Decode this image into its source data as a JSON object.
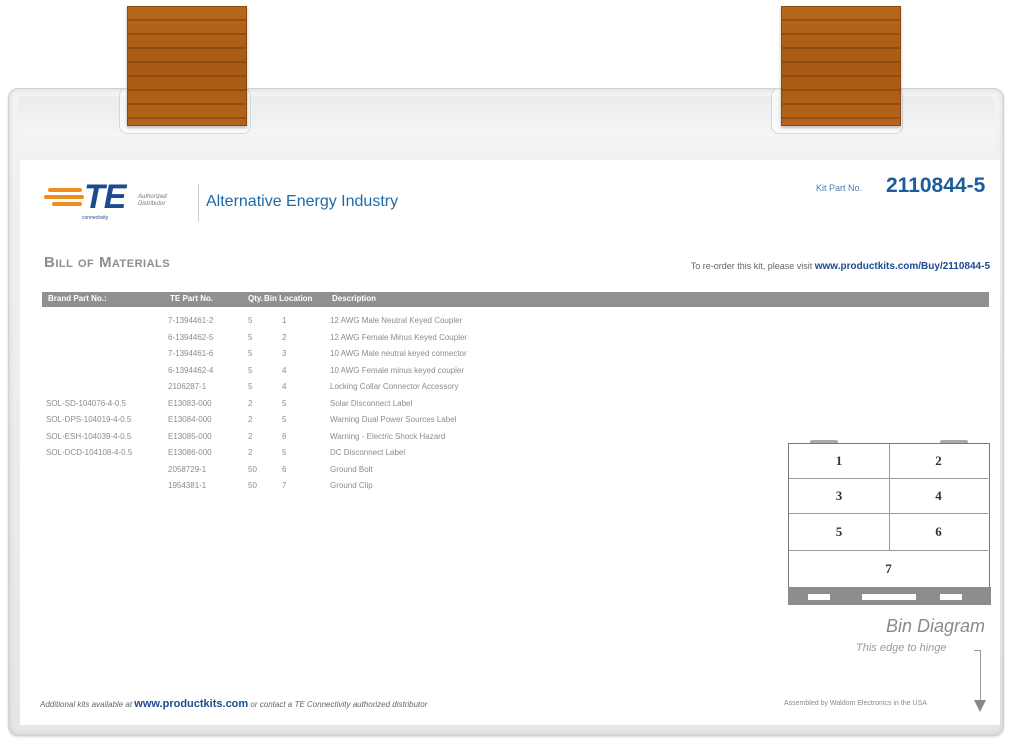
{
  "header": {
    "logo_text": "TE",
    "logo_subtext": "connectivity",
    "authorized_label": "Authorized Distributor",
    "industry": "Alternative Energy Industry",
    "kit_part_label": "Kit Part No.",
    "kit_part_number": "2110844-5"
  },
  "bom": {
    "title": "Bill of Materials",
    "reorder_text": "To re-order this kit, please visit",
    "reorder_url": "www.productkits.com/Buy/2110844-5",
    "columns": [
      "Brand Part No.:",
      "TE Part No.",
      "Qty.",
      "Bin Location",
      "Description"
    ],
    "rows": [
      {
        "brand": "",
        "te": "7-1394461-2",
        "qty": "5",
        "bin": "1",
        "desc": "12 AWG Male Neutral Keyed Coupler"
      },
      {
        "brand": "",
        "te": "6-1394462-5",
        "qty": "5",
        "bin": "2",
        "desc": "12 AWG Female Minus Keyed Coupler"
      },
      {
        "brand": "",
        "te": "7-1394461-6",
        "qty": "5",
        "bin": "3",
        "desc": "10 AWG Male neutral keyed connector"
      },
      {
        "brand": "",
        "te": "6-1394462-4",
        "qty": "5",
        "bin": "4",
        "desc": "10 AWG Female minus keyed coupler"
      },
      {
        "brand": "",
        "te": "2106287-1",
        "qty": "5",
        "bin": "4",
        "desc": "Locking Collar Connector Accessory"
      },
      {
        "brand": "SOL-SD-104076-4-0.5",
        "te": "E13083-000",
        "qty": "2",
        "bin": "5",
        "desc": "Solar Disconnect Label"
      },
      {
        "brand": "SOL-DPS-104019-4-0.5",
        "te": "E13084-000",
        "qty": "2",
        "bin": "5",
        "desc": "Warning Dual Power Sources Label"
      },
      {
        "brand": "SOL-ESH-104039-4-0.5",
        "te": "E13085-000",
        "qty": "2",
        "bin": "6",
        "desc": "Warning - Electric Shock Hazard"
      },
      {
        "brand": "SOL-DCD-104108-4-0.5",
        "te": "E13086-000",
        "qty": "2",
        "bin": "5",
        "desc": "DC Disconnect Label"
      },
      {
        "brand": "",
        "te": "2058729-1",
        "qty": "50",
        "bin": "6",
        "desc": "Ground Bolt"
      },
      {
        "brand": "",
        "te": "1954381-1",
        "qty": "50",
        "bin": "7",
        "desc": "Ground Clip"
      }
    ]
  },
  "bin_diagram": {
    "bins": [
      "1",
      "2",
      "3",
      "4",
      "5",
      "6",
      "7"
    ],
    "caption": "Bin Diagram",
    "hinge_note": "This edge to hinge"
  },
  "footer": {
    "left_prefix": "Additional kits available at",
    "left_url": "www.productkits.com",
    "left_suffix": "or contact a TE Connectivity authorized distributor",
    "right": "Assembled by Waldom Electronics in the USA"
  },
  "colors": {
    "brand_blue": "#1d4b8f",
    "brand_orange": "#f28c1c",
    "header_bar": "#8f918f",
    "hanger": "#b0611a"
  }
}
